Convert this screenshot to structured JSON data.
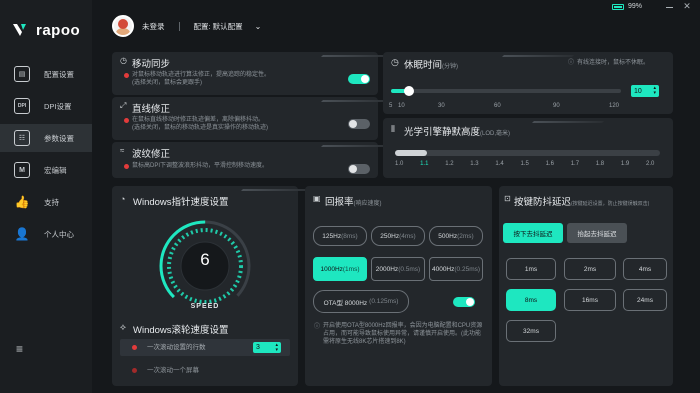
{
  "app": {
    "logo": "rapoo",
    "battery": "99%"
  },
  "sidebar": {
    "items": [
      {
        "label": "配置设置",
        "icon": "E"
      },
      {
        "label": "DPI设置",
        "icon": "DPI"
      },
      {
        "label": "参数设置",
        "icon": "≡"
      },
      {
        "label": "宏编辑",
        "icon": "M"
      },
      {
        "label": "支持",
        "icon": "👍"
      },
      {
        "label": "个人中心",
        "icon": "👤"
      }
    ],
    "footer_icon": "≡"
  },
  "user": {
    "name": "未登录",
    "profile_label": "配置: 默认配置"
  },
  "sync": {
    "title": "移动同步",
    "desc1": "对鼠标移动轨迹进行算法修正，提高追踪的稳定性。",
    "desc2": "(选择关闭，鼠标会更跟手)",
    "enabled": true
  },
  "straight": {
    "title": "直线修正",
    "desc1": "在鼠标直线移动时修正轨迹偏差，离除偏移抖动。",
    "desc2": "(选择关闭，鼠标的移动轨迹是真实操作的移动轨迹)",
    "enabled": false
  },
  "ripple": {
    "title": "波纹修正",
    "desc1": "鼠标高DPI下调整波浪形抖动，平滑控制移动速度。",
    "enabled": false
  },
  "sleep": {
    "title": "休眠时间",
    "unit": "(分钟)",
    "note": "有线连接时，鼠标不休眠。",
    "value": "10",
    "value_fraction": 0.08,
    "ticks": [
      "5",
      "10",
      "30",
      "60",
      "90",
      "120"
    ]
  },
  "lod": {
    "title": "光学引擎静默高度",
    "unit": "(LOD,毫米)",
    "value_fraction": 0.12,
    "ticks": [
      "1.0",
      "1.1",
      "1.2",
      "1.3",
      "1.4",
      "1.5",
      "1.6",
      "1.7",
      "1.8",
      "1.9",
      "2.0"
    ]
  },
  "pointer": {
    "title": "Windows指针速度设置",
    "speed": "6",
    "speed_label": "SPEED",
    "speed_fraction": 0.5
  },
  "scroll": {
    "title": "Windows滚轮速度设置",
    "option1": "一次滚动设置的行数",
    "option1_value": "3",
    "option2": "一次滚动一个屏幕"
  },
  "polling": {
    "title": "回报率",
    "unit": "(响应速度)",
    "rates": [
      {
        "label": "125Hz",
        "ms": "(8ms)"
      },
      {
        "label": "250Hz",
        "ms": "(4ms)"
      },
      {
        "label": "500Hz",
        "ms": "(2ms)"
      },
      {
        "label": "1000Hz",
        "ms": "(1ms)"
      },
      {
        "label": "2000Hz",
        "ms": "(0.5ms)"
      },
      {
        "label": "4000Hz",
        "ms": "(0.25ms)"
      }
    ],
    "ota_label": "OTA型 8000Hz",
    "ota_ms": "(0.125ms)",
    "ota_enabled": true,
    "note": "开启使用OTA型8000Hz回报率，会因为电脑配置和CPU资源占用，而可能导致鼠标使用异常，请谨慎开启使用。(此功能需将原生无线8K芯片搭速到8K)"
  },
  "debounce": {
    "title": "按键防抖延迟",
    "unit": "(按键延迟设置，防止按键误触双击)",
    "press": "按下去抖延迟",
    "release": "抬起去抖延迟",
    "values": [
      "1ms",
      "2ms",
      "4ms",
      "8ms",
      "16ms",
      "24ms",
      "32ms"
    ]
  }
}
